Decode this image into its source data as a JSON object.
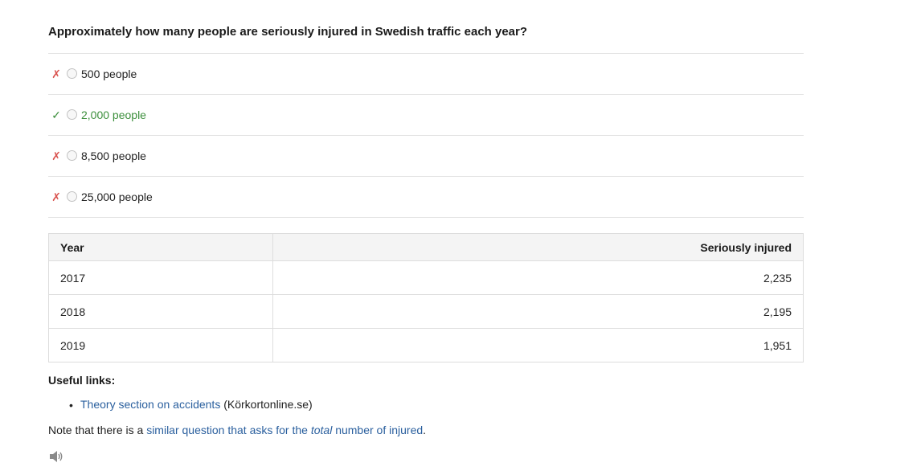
{
  "question": "Approximately how many people are seriously injured in Swedish traffic each year?",
  "options": [
    {
      "label": "500 people",
      "mark": "✗",
      "correct": false
    },
    {
      "label": "2,000 people",
      "mark": "✓",
      "correct": true
    },
    {
      "label": "8,500 people",
      "mark": "✗",
      "correct": false
    },
    {
      "label": "25,000 people",
      "mark": "✗",
      "correct": false
    }
  ],
  "table": {
    "headers": [
      "Year",
      "Seriously injured"
    ],
    "rows": [
      [
        "2017",
        "2,235"
      ],
      [
        "2018",
        "2,195"
      ],
      [
        "2019",
        "1,951"
      ]
    ]
  },
  "links": {
    "heading": "Useful links:",
    "items": [
      {
        "link_text": "Theory section on accidents",
        "suffix": " (Körkortonline.se)"
      }
    ]
  },
  "note": {
    "prefix": "Note that there is a ",
    "link_part1": "similar question that asks for the ",
    "link_emph": "total",
    "link_part2": " number of injured",
    "suffix": "."
  },
  "icons": {
    "speaker": "speaker-icon"
  },
  "colors": {
    "correct": "#3c8f3c",
    "wrong": "#d9534f",
    "link": "#2a5f9e"
  }
}
